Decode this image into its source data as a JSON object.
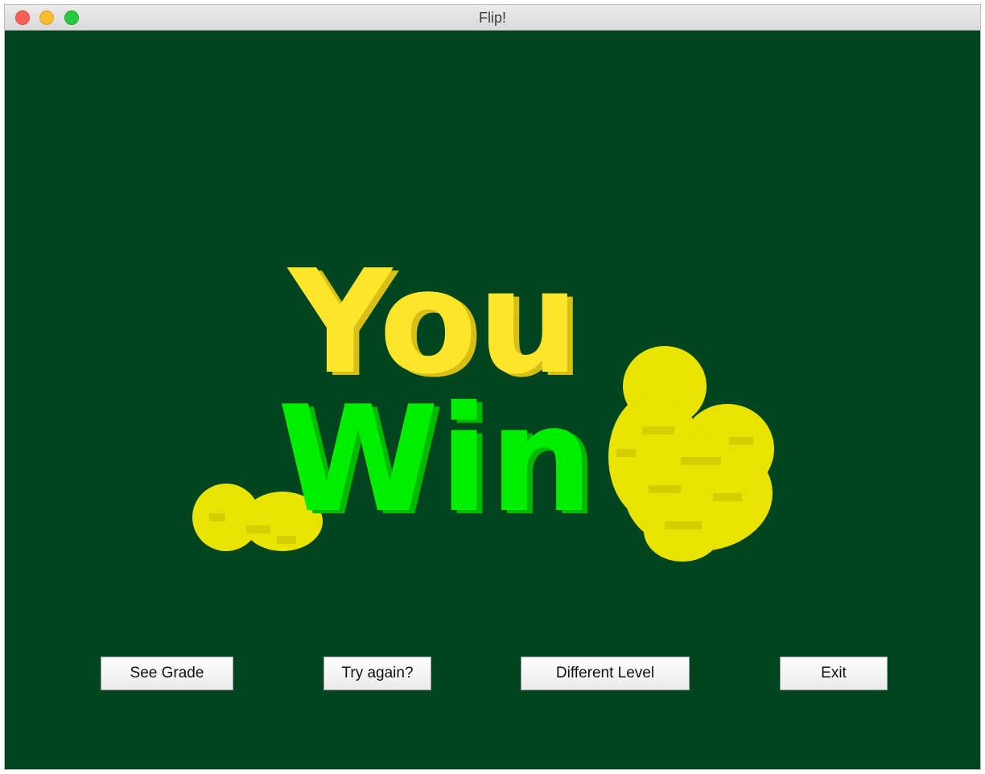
{
  "window": {
    "title": "Flip!"
  },
  "banner": {
    "line1": "You",
    "line2": "Win",
    "line1_color": "#fde52a",
    "line1_shadow": "#d8bf18",
    "line2_color": "#00ee00",
    "line2_shadow": "#00b800",
    "coin_color": "#e8e300",
    "coin_shade": "#d6cf00"
  },
  "colors": {
    "background": "#01451f"
  },
  "buttons": {
    "see_grade": "See Grade",
    "try_again": "Try again?",
    "different_level": "Different Level",
    "exit": "Exit"
  }
}
